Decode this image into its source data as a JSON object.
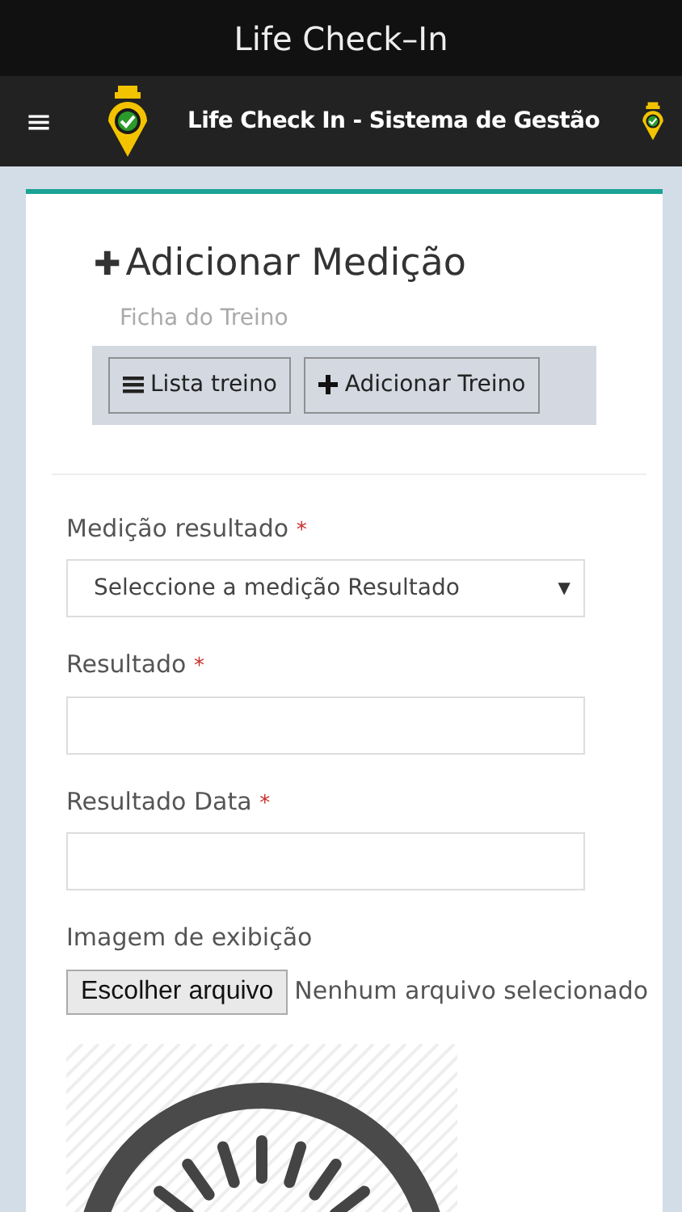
{
  "app_bar": {
    "title": "Life Check–In"
  },
  "navbar": {
    "menu_icon": "≡",
    "title": "Life Check In - Sistema de Gestão"
  },
  "header": {
    "icon": "✚",
    "title": "Adicionar Medição",
    "subtitle": "Ficha do Treino",
    "buttons": [
      {
        "kind": "list",
        "label": "Lista treino"
      },
      {
        "kind": "add",
        "label": "Adicionar Treino"
      }
    ]
  },
  "form": {
    "fields": [
      {
        "kind": "select",
        "label": "Medição resultado",
        "required_mark": "*",
        "placeholder": "Seleccione a medição Resultado",
        "caret": "▼"
      },
      {
        "kind": "text",
        "label": "Resultado",
        "required_mark": "*"
      },
      {
        "kind": "text",
        "label": "Resultado Data",
        "required_mark": "*"
      },
      {
        "kind": "file",
        "label": "Imagem de exibição",
        "button": "Escolher arquivo",
        "status": "Nenhum arquivo selecionado"
      }
    ]
  }
}
